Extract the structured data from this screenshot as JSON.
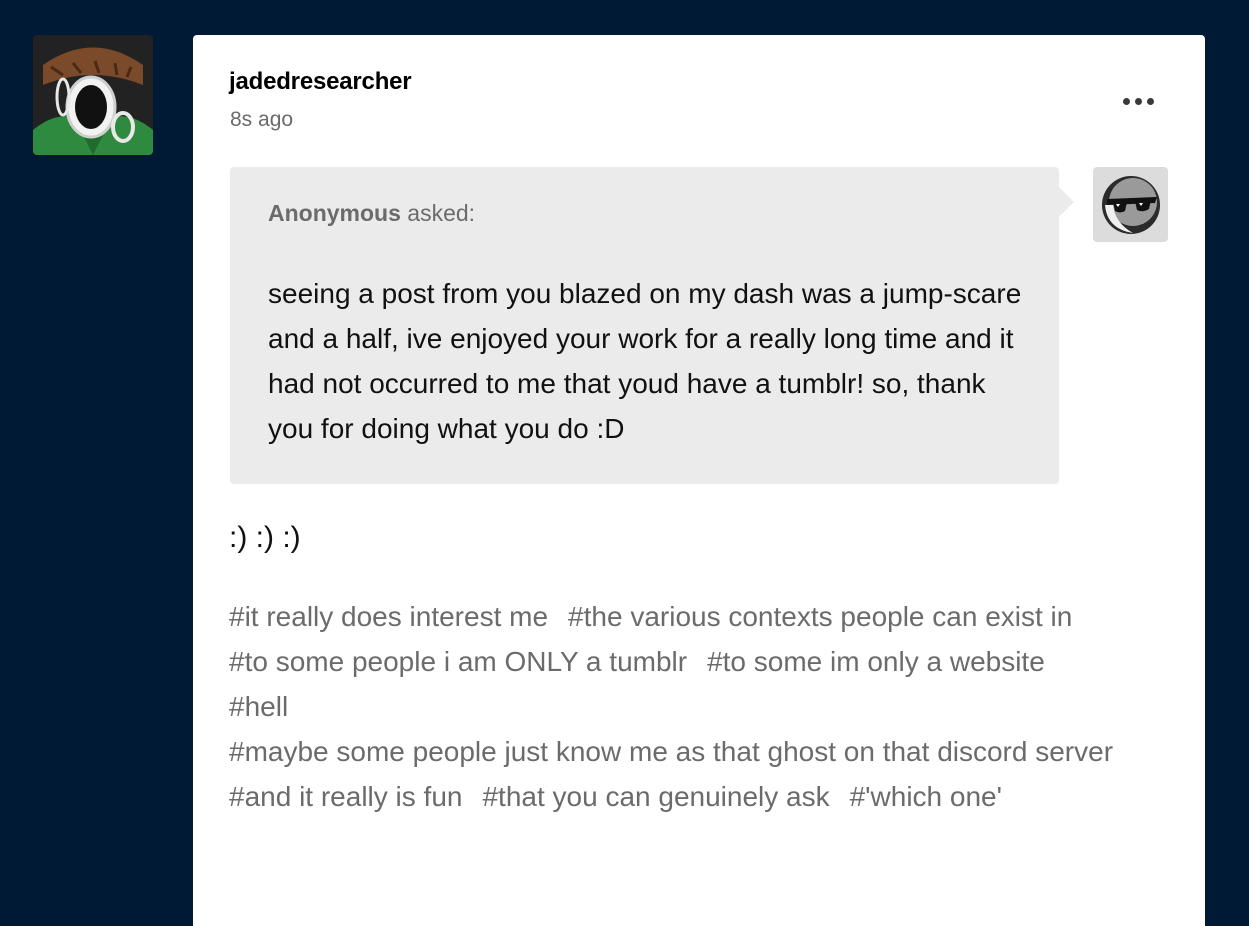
{
  "post": {
    "blog_name": "jadedresearcher",
    "timestamp": "8s ago",
    "more_options_icon": "ellipsis-icon",
    "ask": {
      "asker_name": "Anonymous",
      "asked_label": "asked:",
      "question": "seeing a post from you blazed on my dash was a jump-scare and a half, ive enjoyed your work for a really long time and it had not occurred to me that youd have a tumblr! so, thank you for doing what you do :D",
      "asker_avatar_icon": "anonymous-sunglasses-icon"
    },
    "answer": ":) :) :)",
    "tags": [
      "#it really does interest me",
      "#the various contexts people can exist in",
      "#to some people i am ONLY a tumblr",
      "#to some im only a website",
      "#hell",
      "#maybe some people just know me as that ghost on that discord server",
      "#and it really is fun",
      "#that you can genuinely ask",
      "#'which one'"
    ]
  },
  "colors": {
    "background": "#001935",
    "card": "#ffffff",
    "ask_bubble": "#ebebeb",
    "tag_text": "#6b6b6b"
  }
}
